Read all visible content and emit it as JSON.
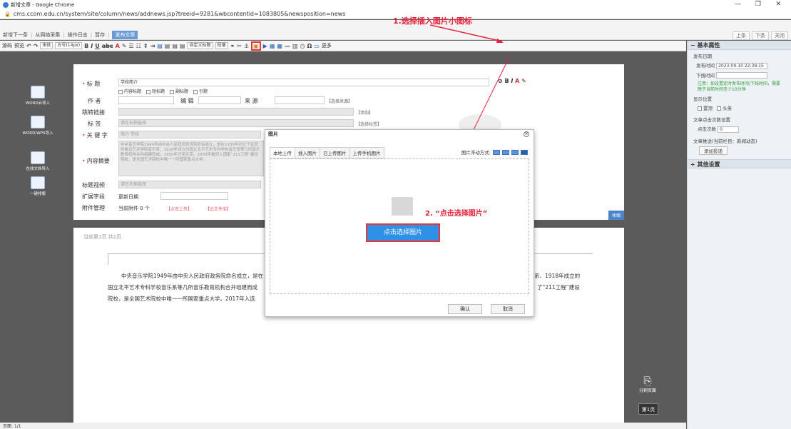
{
  "window": {
    "title": "新增文章 - Google Chrome",
    "url": "cms.ccom.edu.cn/system/site/column/news/addnews.jsp?treeid=9281&wbcontentid=1083805&newsposition=news"
  },
  "annotations": {
    "a1": "1.选择插入图片小图标",
    "a2": "2. “点击选择图片”"
  },
  "toolbar1": {
    "items": [
      "新增下一条",
      "从网络采集",
      "操作日志",
      "暂存"
    ],
    "publish": "发布文章",
    "right": [
      "上条",
      "下条",
      "关闭"
    ]
  },
  "toolbar2": {
    "source": "源码",
    "preview": "预览",
    "font": "宋体",
    "size": "五号(14px)",
    "fmt": "自定义标题",
    "para": "段落",
    "more": "更多"
  },
  "right_panel": {
    "basic": "基本属性",
    "pubdate_h": "发布日期",
    "pubtime_label": "发布时间",
    "pubtime": "2023-09-10 22:38:15",
    "offtime_label": "下线时间",
    "note": "注意：如设置定时发布时间/下线时间，需要晚于当前时间至少10分钟",
    "display_h": "显示位置",
    "top": "置顶",
    "headline": "头条",
    "clicks_h": "文章点击次数设置",
    "clicks_label": "点击次数",
    "clicks": "0",
    "push_h": "文章推送(当前栏目：新闻动态)",
    "push_btn": "添加投递",
    "other": "其他设置"
  },
  "left_nav": [
    "WORD云导入",
    "WORD/WPS导入",
    "在线文档导入",
    "一键排版"
  ],
  "form": {
    "title_label": "标  题",
    "title": "学校简介",
    "checks": [
      "内容标题",
      "短标题",
      "副标题",
      "引题"
    ],
    "author_label": "作  者",
    "editor_label": "编  辑",
    "source_label": "来  源",
    "source_link": "【选择来源】",
    "jump_label": "跳转链接",
    "add_link": "【添加】",
    "tag_label": "标  签",
    "tag_ph": "请在右侧选择",
    "tag_link": "【选择标签】",
    "kw_label": "关 键 字",
    "kw": "简介 学校",
    "summary_label": "内容摘要",
    "summary": "中央音乐学院1949年由中央人民政府政务院命名成立，是在1938年创立于延安的鲁迅艺术学院音乐系、1918年成立的国立北平艺术专科学校音乐系等几所音乐教育机构合并组建而成。1950年迁至北京。2000年被列入国家“211工程”建设院校，是全国艺术院校中唯一一所国家重点大学。",
    "video_label": "标题视频",
    "video_ph": "请在右侧选择",
    "ext_label": "扩展字段",
    "ext_sub": "更新日期",
    "attach_label": "附件管理",
    "attach_text": "当前附件 0 个",
    "upload": "【点击上传】",
    "cloud": "【云文件库】",
    "collapse": "收缩"
  },
  "editor": {
    "page": "当前第1页  共1页",
    "p1": "中央音乐学院1949年由中央人民政府政务院命名成立，是在",
    "p1r": "系、1918年成立的",
    "p2": "国立北平艺术专科学校音乐系等几所音乐教育机构合并组建而成",
    "p2r": "了“211工程”建设",
    "p3": "院校，是全国艺术院校中唯一一所国家重点大学。2017年入选"
  },
  "dialog": {
    "title": "图片",
    "tabs": [
      "本地上传",
      "插入图片",
      "已上传图片",
      "上传手机图片"
    ],
    "float_label": "图片浮动方式:",
    "select_btn": "点击选择图片",
    "ok": "确认",
    "cancel": "取消"
  },
  "split": {
    "label": "分割页面",
    "page": "第1页"
  },
  "status": {
    "page": "页面: 1/1"
  }
}
